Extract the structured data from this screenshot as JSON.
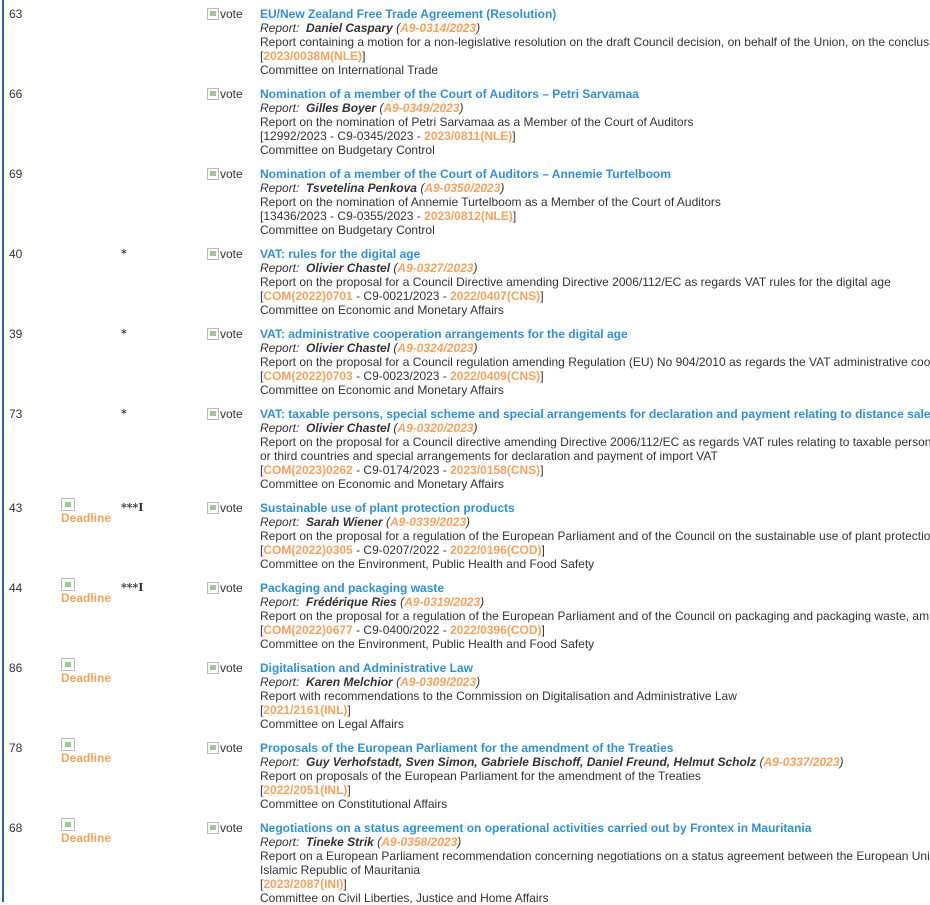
{
  "labels": {
    "report_prefix": "Report:",
    "vote_alt": "vote",
    "deadline_alt": "Deadline"
  },
  "colors": {
    "title_link": "#2f8fd8",
    "reference_link": "#f5a25d",
    "left_border": "#2f63a8"
  },
  "items": [
    {
      "number": "63",
      "procedure": "",
      "has_deadline": false,
      "title": "EU/New Zealand Free Trade Agreement (Resolution)",
      "rapporteur": "Daniel Caspary",
      "report_ref": "A9-0314/2023",
      "description": [
        "Report containing a motion for a non-legislative resolution on the draft Council decision, on behalf of the Union, on the conclusi"
      ],
      "refs_pre": "",
      "refs_link1": "",
      "refs_mid": "",
      "refs_link2": "2023/0038M(NLE)",
      "committee": "Committee on International Trade"
    },
    {
      "number": "66",
      "procedure": "",
      "has_deadline": false,
      "title": "Nomination of a member of the Court of Auditors – Petri Sarvamaa",
      "rapporteur": "Gilles Boyer",
      "report_ref": "A9-0349/2023",
      "description": [
        "Report on the nomination of Petri Sarvamaa as a Member of the Court of Auditors"
      ],
      "refs_pre": "12992/2023 - C9-0345/2023 - ",
      "refs_link1": "",
      "refs_mid": "",
      "refs_link2": "2023/0811(NLE)",
      "committee": "Committee on Budgetary Control"
    },
    {
      "number": "69",
      "procedure": "",
      "has_deadline": false,
      "title": "Nomination of a member of the Court of Auditors – Annemie Turtelboom",
      "rapporteur": "Tsvetelina Penkova",
      "report_ref": "A9-0350/2023",
      "description": [
        "Report on the nomination of Annemie Turtelboom as a Member of the Court of Auditors"
      ],
      "refs_pre": "13436/2023 - C9-0355/2023 - ",
      "refs_link1": "",
      "refs_mid": "",
      "refs_link2": "2023/0812(NLE)",
      "committee": "Committee on Budgetary Control"
    },
    {
      "number": "40",
      "procedure": "*",
      "has_deadline": false,
      "title": "VAT: rules for the digital age",
      "rapporteur": "Olivier Chastel",
      "report_ref": "A9-0327/2023",
      "description": [
        "Report on the proposal for a Council Directive amending Directive 2006/112/EC as regards VAT rules for the digital age"
      ],
      "refs_pre": "",
      "refs_link1": "COM(2022)0701",
      "refs_mid": " - C9-0021/2023 - ",
      "refs_link2": "2022/0407(CNS)",
      "committee": "Committee on Economic and Monetary Affairs"
    },
    {
      "number": "39",
      "procedure": "*",
      "has_deadline": false,
      "title": "VAT: administrative cooperation arrangements for the digital age",
      "rapporteur": "Olivier Chastel",
      "report_ref": "A9-0324/2023",
      "description": [
        "Report on the proposal for a Council regulation amending Regulation (EU) No 904/2010 as regards the VAT administrative coo"
      ],
      "refs_pre": "",
      "refs_link1": "COM(2022)0703",
      "refs_mid": " - C9-0023/2023 - ",
      "refs_link2": "2022/0409(CNS)",
      "committee": "Committee on Economic and Monetary Affairs"
    },
    {
      "number": "73",
      "procedure": "*",
      "has_deadline": false,
      "title": "VAT: taxable persons, special scheme and special arrangements for declaration and payment relating to distance sale",
      "rapporteur": "Olivier Chastel",
      "report_ref": "A9-0320/2023",
      "description": [
        "Report on the proposal for a Council directive amending Directive 2006/112/EC as regards VAT rules relating to taxable person",
        "or third countries and special arrangements for declaration and payment of import VAT"
      ],
      "refs_pre": "",
      "refs_link1": "COM(2023)0262",
      "refs_mid": " - C9-0174/2023 - ",
      "refs_link2": "2023/0158(CNS)",
      "committee": "Committee on Economic and Monetary Affairs"
    },
    {
      "number": "43",
      "procedure": "***I",
      "has_deadline": true,
      "title": "Sustainable use of plant protection products",
      "rapporteur": "Sarah Wiener",
      "report_ref": "A9-0339/2023",
      "description": [
        "Report on the proposal for a regulation of the European Parliament and of the Council on the sustainable use of plant protectio"
      ],
      "refs_pre": "",
      "refs_link1": "COM(2022)0305",
      "refs_mid": " - C9-0207/2022 - ",
      "refs_link2": "2022/0196(COD)",
      "committee": "Committee on the Environment, Public Health and Food Safety"
    },
    {
      "number": "44",
      "procedure": "***I",
      "has_deadline": true,
      "title": "Packaging and packaging waste",
      "rapporteur": "Frédérique Ries",
      "report_ref": "A9-0319/2023",
      "description": [
        "Report on the proposal for a regulation of the European Parliament and of the Council on packaging and packaging waste, am"
      ],
      "refs_pre": "",
      "refs_link1": "COM(2022)0677",
      "refs_mid": " - C9-0400/2022 - ",
      "refs_link2": "2022/0396(COD)",
      "committee": "Committee on the Environment, Public Health and Food Safety"
    },
    {
      "number": "86",
      "procedure": "",
      "has_deadline": true,
      "title": "Digitalisation and Administrative Law",
      "rapporteur": "Karen Melchior",
      "report_ref": "A9-0309/2023",
      "description": [
        "Report with recommendations to the Commission on Digitalisation and Administrative Law"
      ],
      "refs_pre": "",
      "refs_link1": "",
      "refs_mid": "",
      "refs_link2": "2021/2161(INL)",
      "committee": "Committee on Legal Affairs"
    },
    {
      "number": "78",
      "procedure": "",
      "has_deadline": true,
      "title": "Proposals of the European Parliament for the amendment of the Treaties",
      "rapporteur": "Guy Verhofstadt, Sven Simon, Gabriele Bischoff, Daniel Freund, Helmut Scholz",
      "report_ref": "A9-0337/2023",
      "description": [
        "Report on proposals of the European Parliament for the amendment of the Treaties"
      ],
      "refs_pre": "",
      "refs_link1": "",
      "refs_mid": "",
      "refs_link2": "2022/2051(INL)",
      "committee": "Committee on Constitutional Affairs"
    },
    {
      "number": "68",
      "procedure": "",
      "has_deadline": true,
      "title": "Negotiations on a status agreement on operational activities carried out by Frontex in Mauritania",
      "rapporteur": "Tineke Strik",
      "report_ref": "A9-0358/2023",
      "description": [
        "Report on a European Parliament recommendation concerning negotiations on a status agreement between the European Uni",
        "Islamic Republic of Mauritania"
      ],
      "refs_pre": "",
      "refs_link1": "",
      "refs_mid": "",
      "refs_link2": "2023/2087(INI)",
      "committee": "Committee on Civil Liberties, Justice and Home Affairs"
    }
  ]
}
